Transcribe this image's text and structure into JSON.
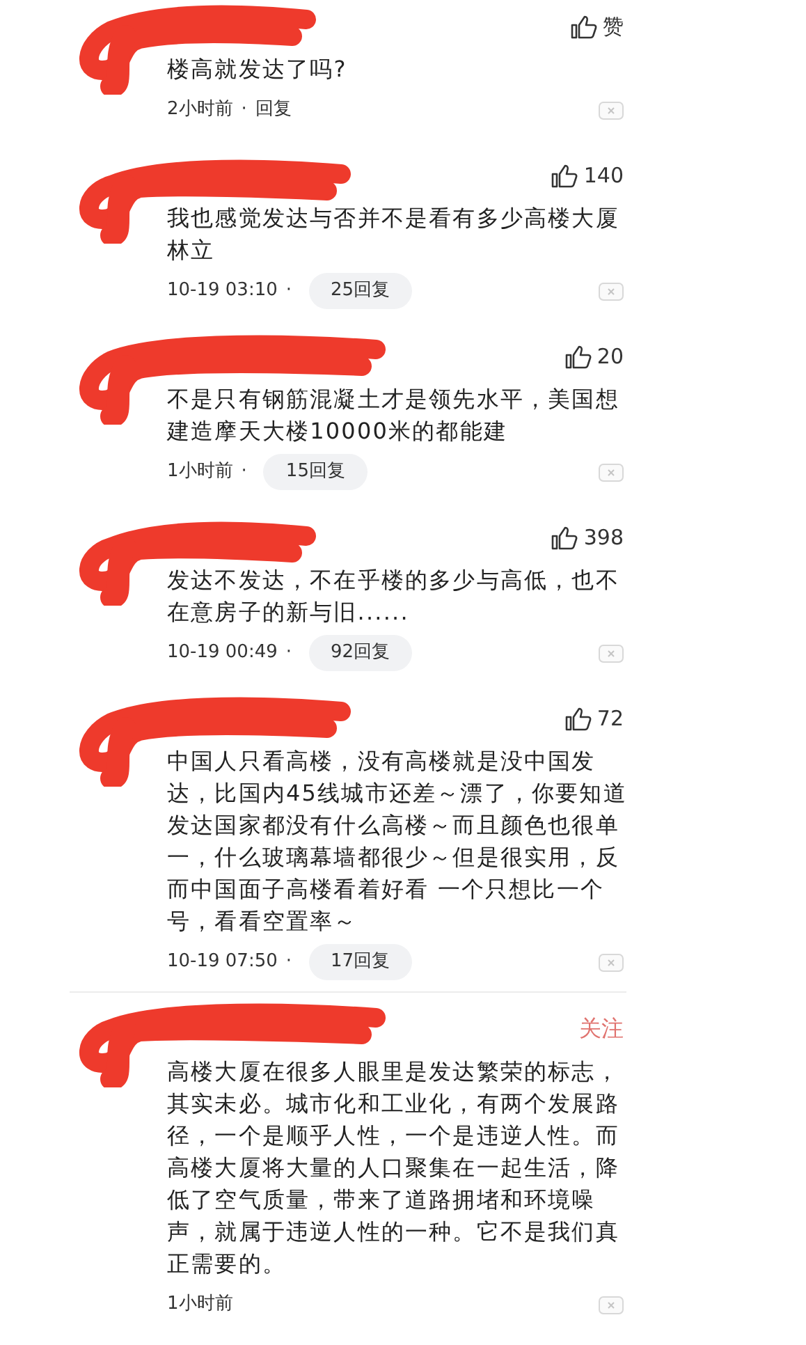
{
  "comments": [
    {
      "action": {
        "kind": "like",
        "label": "赞"
      },
      "text": "楼高就发达了吗?",
      "time": "2小时前",
      "reply": {
        "kind": "link",
        "separator": "·",
        "label": "回复"
      }
    },
    {
      "action": {
        "kind": "like",
        "label": "140"
      },
      "text": "我也感觉发达与否并不是看有多少高楼大厦林立",
      "time": "10-19 03:10",
      "reply": {
        "kind": "pill",
        "separator": "·",
        "label": "25回复"
      }
    },
    {
      "action": {
        "kind": "like",
        "label": "20"
      },
      "text": "不是只有钢筋混凝土才是领先水平，美国想建造摩天大楼10000米的都能建",
      "time": "1小时前",
      "reply": {
        "kind": "pill",
        "separator": "·",
        "label": "15回复"
      }
    },
    {
      "action": {
        "kind": "like",
        "label": "398"
      },
      "text": "发达不发达，不在乎楼的多少与高低，也不在意房子的新与旧......",
      "time": "10-19 00:49",
      "reply": {
        "kind": "pill",
        "separator": "·",
        "label": "92回复"
      }
    },
    {
      "action": {
        "kind": "like",
        "label": "72"
      },
      "text": "中国人只看高楼，没有高楼就是没中国发达，比国内45线城市还差～漂了，你要知道发达国家都没有什么高楼～而且颜色也很单一，什么玻璃幕墙都很少～但是很实用，反而中国面子高楼看着好看 一个只想比一个号，看看空置率～",
      "time": "10-19 07:50",
      "reply": {
        "kind": "pill",
        "separator": "·",
        "label": "17回复"
      }
    },
    {
      "action": {
        "kind": "follow",
        "label": "关注"
      },
      "text": "高楼大厦在很多人眼里是发达繁荣的标志，其实未必。城市化和工业化，有两个发展路径，一个是顺乎人性，一个是违逆人性。而高楼大厦将大量的人口聚集在一起生活，降低了空气质量，带来了道路拥堵和环境噪声，就属于违逆人性的一种。它不是我们真正需要的。",
      "time": "1小时前"
    }
  ]
}
